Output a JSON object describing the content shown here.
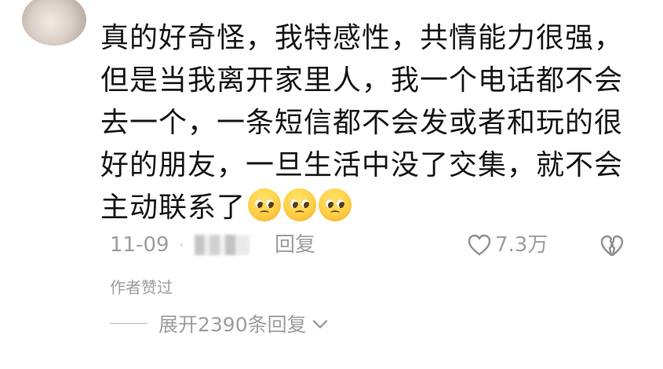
{
  "comment": {
    "username": "",
    "lines": [
      "真的好奇怪，我特感性，共情能力很强，",
      "但是当我离开家里人，我一个电话都不会",
      "去一个，一条短信都不会发或者和玩的很",
      "好的朋友，一旦生活中没了交集，就不会",
      "主动联系了"
    ],
    "emojis": [
      "pleading-face",
      "pleading-face",
      "pleading-face"
    ],
    "date": "11-09",
    "separator": "·",
    "reply_label": "回复",
    "like_count": "7.3万",
    "author_liked": "作者赞过",
    "expand_replies": "展开2390条回复"
  },
  "colors": {
    "text": "#151515",
    "secondary": "#9d9d9d",
    "emoji": "#ffd24a"
  }
}
